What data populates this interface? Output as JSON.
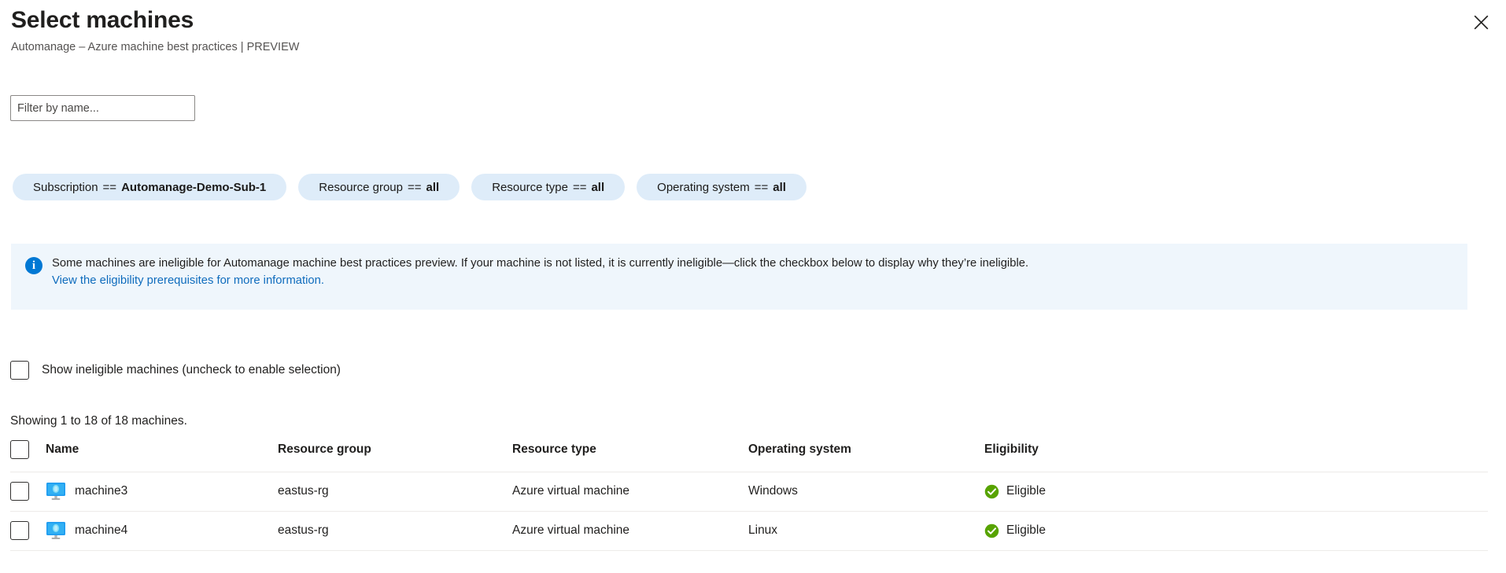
{
  "header": {
    "title": "Select machines",
    "subtitle": "Automanage – Azure machine best practices | PREVIEW",
    "close_icon": "close-icon"
  },
  "search": {
    "placeholder": "Filter by name...",
    "value": ""
  },
  "filters": [
    {
      "key": "Subscription",
      "op": "==",
      "value": "Automanage-Demo-Sub-1"
    },
    {
      "key": "Resource group",
      "op": "==",
      "value": "all"
    },
    {
      "key": "Resource type",
      "op": "==",
      "value": "all"
    },
    {
      "key": "Operating system",
      "op": "==",
      "value": "all"
    }
  ],
  "info_banner": {
    "icon": "info-icon",
    "text": "Some machines are ineligible for Automanage machine best practices preview. If your machine is not listed, it is currently ineligible—click the checkbox below to display why they’re ineligible.",
    "link_text": "View the eligibility prerequisites for more information.",
    "background": "#eff6fc",
    "icon_color": "#0078d4",
    "link_color": "#0f6cbd"
  },
  "show_ineligible": {
    "label": "Show ineligible machines (uncheck to enable selection)",
    "checked": false
  },
  "showing_count": "Showing 1 to 18 of 18 machines.",
  "table": {
    "select_all_checked": false,
    "columns": [
      "Name",
      "Resource group",
      "Resource type",
      "Operating system",
      "Eligibility"
    ],
    "rows": [
      {
        "checked": false,
        "icon": "virtual-machine-icon",
        "name": "machine3",
        "resource_group": "eastus-rg",
        "resource_type": "Azure virtual machine",
        "operating_system": "Windows",
        "eligibility": "Eligible",
        "eligibility_icon": "check-circle-icon"
      },
      {
        "checked": false,
        "icon": "virtual-machine-icon",
        "name": "machine4",
        "resource_group": "eastus-rg",
        "resource_type": "Azure virtual machine",
        "operating_system": "Linux",
        "eligibility": "Eligible",
        "eligibility_icon": "check-circle-icon"
      }
    ]
  },
  "colors": {
    "pill_background": "#deecf9",
    "eligible_green": "#57a300",
    "accent_blue": "#0078d4",
    "text_primary": "#201f1e",
    "text_secondary": "#555352",
    "row_divider": "#edebe9"
  }
}
